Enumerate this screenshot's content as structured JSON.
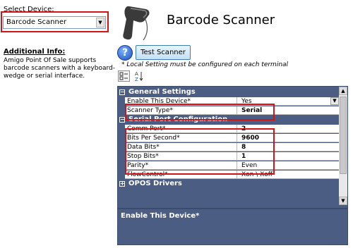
{
  "left": {
    "select_label": "Select Device:",
    "device_value": "Barcode Scanner",
    "additional_title": "Additional Info:",
    "additional_body": "Amigo Point Of Sale supports barcode scanners with a keyboard-wedge or serial interface."
  },
  "header": {
    "title": "Barcode Scanner"
  },
  "toolbar": {
    "help_glyph": "?",
    "test_label": "Test Scanner",
    "note": "* Local Setting must be configured on each terminal",
    "categorized_icon": "categorized-icon",
    "alphabetical_icon": "sort-alphabetical-icon"
  },
  "grid": {
    "cat_general": "General Settings",
    "cat_serial": "Serial Port Configuration",
    "cat_opos": "OPOS Drivers",
    "rows": [
      {
        "name": "Enable This Device*",
        "value": "Yes"
      },
      {
        "name": "Scanner Type*",
        "value": "Serial"
      },
      {
        "name": "Comm Port*",
        "value": "2"
      },
      {
        "name": "Bits Per Second*",
        "value": "9600"
      },
      {
        "name": "Data Bits*",
        "value": "8"
      },
      {
        "name": "Stop Bits*",
        "value": "1"
      },
      {
        "name": "Parity*",
        "value": "Even"
      },
      {
        "name": "FlowControl*",
        "value": "Xon \\ Xoff"
      }
    ],
    "description": "Enable This Device*"
  },
  "colors": {
    "highlight_red": "#d01417",
    "grid_header": "#4b5d82",
    "button_blue": "#c4e1f5"
  }
}
